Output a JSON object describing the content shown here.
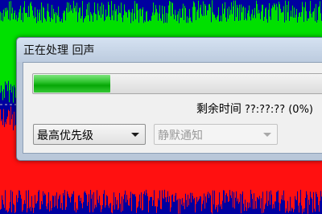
{
  "waveform": {
    "background_color": "#0000a0",
    "top_channel_color": "#00e000",
    "bottom_channel_color": "#ff1010",
    "separator_color": "#c8c8c8"
  },
  "dialog": {
    "title": "正在处理 回声",
    "progress": {
      "fraction": 0.26,
      "fill_color": "#12b012"
    },
    "time_remaining_label": "剩余时间",
    "time_remaining_value": "??:??:?? (0%)",
    "priority_select": {
      "value": "最高优先级",
      "icon": "chevron-down-icon"
    },
    "notify_select": {
      "value": "静默通知",
      "disabled": true,
      "icon": "chevron-down-icon"
    }
  }
}
